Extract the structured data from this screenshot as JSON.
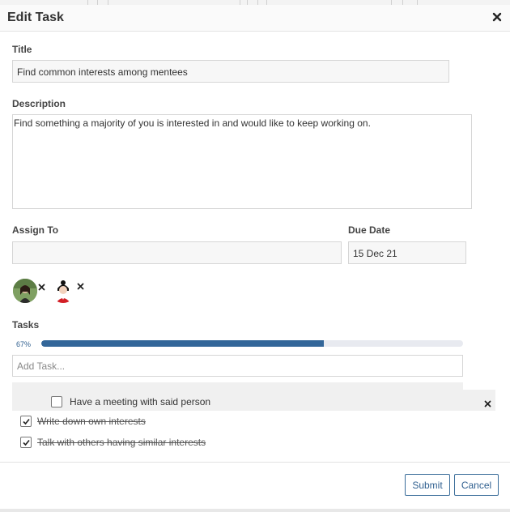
{
  "header": {
    "title": "Edit Task"
  },
  "form": {
    "title_label": "Title",
    "title_value": "Find common interests among mentees",
    "description_label": "Description",
    "description_value": "Find something a majority of you is interested in and would like to keep working on.",
    "assign_label": "Assign To",
    "assign_value": "",
    "due_label": "Due Date",
    "due_value": "15 Dec 21"
  },
  "assignees": [
    {
      "icon": "avatar-photo-icon"
    },
    {
      "icon": "avatar-illustration-icon"
    }
  ],
  "tasks": {
    "label": "Tasks",
    "progress_text": "67%",
    "progress_fraction": 0.67,
    "add_placeholder": "Add Task...",
    "items": [
      {
        "text": "Have a meeting with said person",
        "checked": false
      },
      {
        "text": "Write down own interests",
        "checked": true
      },
      {
        "text": "Talk with others having similar interests",
        "checked": true
      }
    ]
  },
  "footer": {
    "submit_label": "Submit",
    "cancel_label": "Cancel"
  },
  "colors": {
    "accent": "#336699",
    "track": "#e8eaf0"
  }
}
